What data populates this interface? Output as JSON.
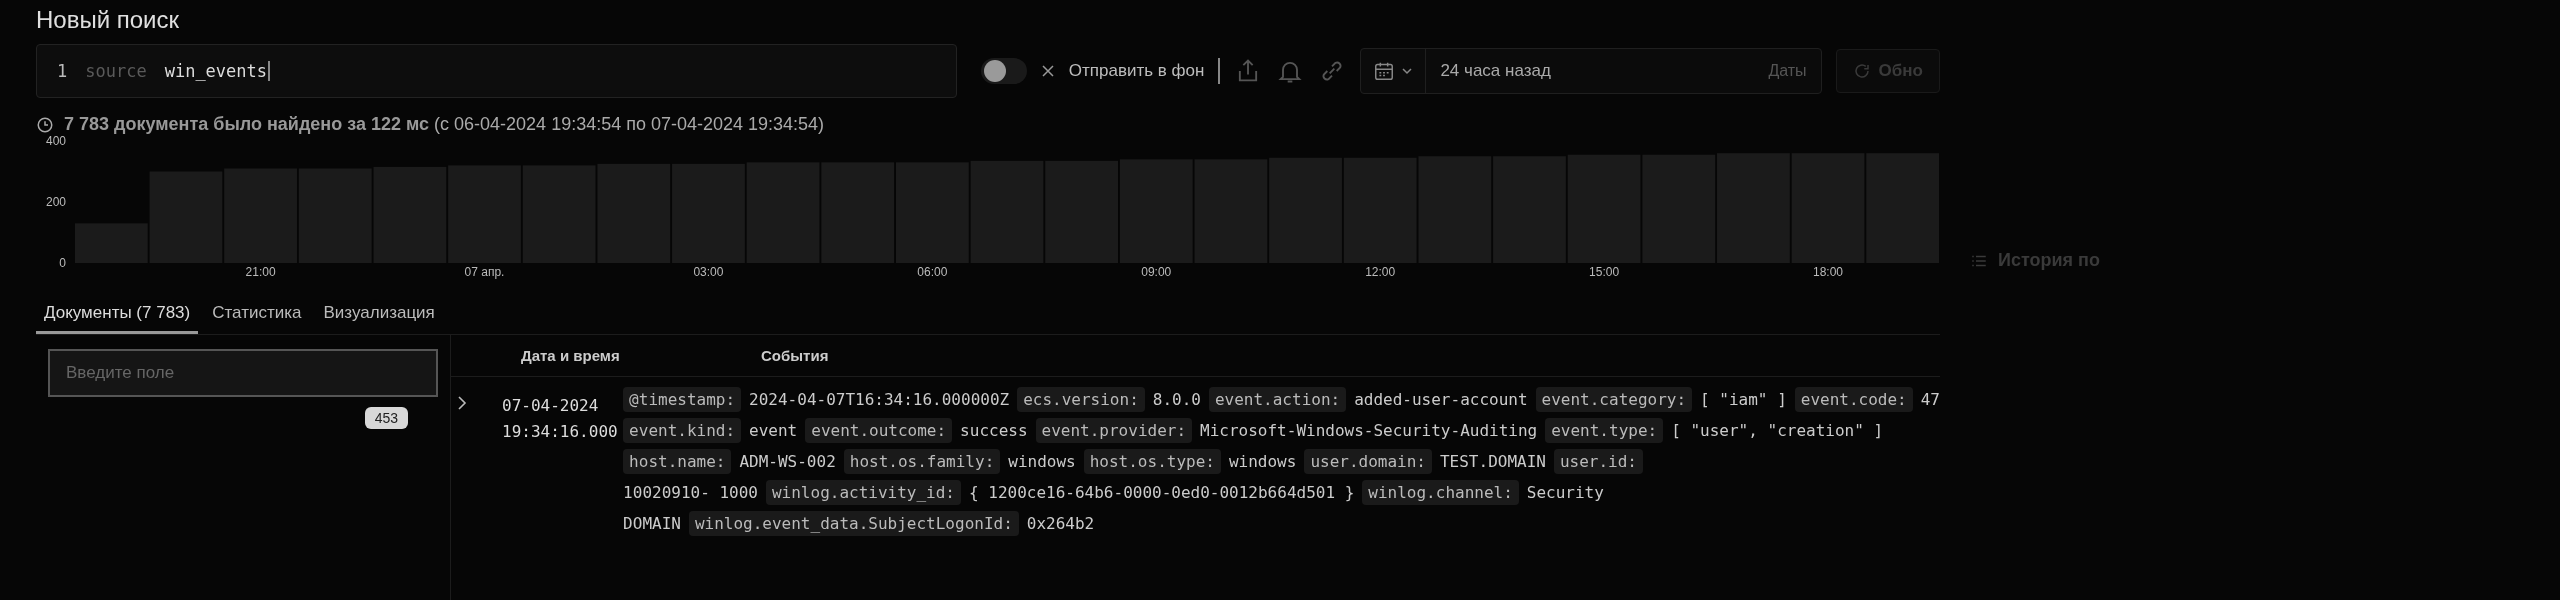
{
  "title": "Новый поиск",
  "query": {
    "line_number": "1",
    "keyword": "source",
    "value": "win_events"
  },
  "background_toggle": {
    "on": false,
    "label": "Отправить в фон"
  },
  "date_range": {
    "value": "24 часа назад",
    "label": "Даты"
  },
  "refresh_button": {
    "label": "Обно"
  },
  "summary": "**7 783 документа было найдено за 122 мс** (с 06-04-2024 19:34:54 по 07-04-2024 19:34:54)",
  "chart_data": {
    "type": "bar",
    "categories": [
      null,
      null,
      "21:00",
      null,
      null,
      "07 апр.",
      null,
      null,
      "03:00",
      null,
      null,
      "06:00",
      null,
      null,
      "09:00",
      null,
      null,
      "12:00",
      null,
      null,
      "15:00",
      null,
      null,
      "18:00",
      null
    ],
    "values": [
      130,
      300,
      310,
      310,
      315,
      320,
      320,
      325,
      325,
      330,
      330,
      330,
      335,
      335,
      340,
      340,
      345,
      345,
      350,
      350,
      355,
      355,
      360,
      360,
      360
    ],
    "ylim": [
      0,
      400
    ],
    "yticks": [
      0,
      200,
      400
    ]
  },
  "history_panel": {
    "title": "История по"
  },
  "tabs": [
    {
      "label": "Документы (7 783)",
      "selected": true
    },
    {
      "label": "Статистика",
      "selected": false
    },
    {
      "label": "Визуализация",
      "selected": false
    }
  ],
  "field_search": {
    "placeholder": "Введите поле"
  },
  "field_count": "453",
  "table": {
    "columns": [
      "Дата и время",
      "События"
    ],
    "rows": [
      {
        "expanded": false,
        "date": "07-04-2024",
        "time": "19:34:16.000",
        "lines": [
          [
            {
              "key": "@timestamp:",
              "value": "2024-04-07T16:34:16.000000Z"
            },
            {
              "key": "ecs.version:",
              "value": "8.0.0"
            },
            {
              "key": "event.action:",
              "value": "added-user-account"
            },
            {
              "key": "event.category:",
              "value": "[ \"iam\" ]"
            },
            {
              "key": "event.code:",
              "value": "47"
            }
          ],
          [
            {
              "key": "event.kind:",
              "value": "event"
            },
            {
              "key": "event.outcome:",
              "value": "success"
            },
            {
              "key": "event.provider:",
              "value": "Microsoft-Windows-Security-Auditing"
            },
            {
              "key": "event.type:",
              "value": "[ \"user\", \"creation\" ]"
            }
          ],
          [
            {
              "key": "host.name:",
              "value": "ADM-WS-002"
            },
            {
              "key": "host.os.family:",
              "value": "windows"
            },
            {
              "key": "host.os.type:",
              "value": "windows"
            },
            {
              "key": "user.domain:",
              "value": "TEST.DOMAIN"
            },
            {
              "key": "user.id:"
            }
          ],
          [
            {
              "value": "10020910- 1000"
            },
            {
              "key": "winlog.activity_id:",
              "value": "{ 1200ce16-64b6-0000-0ed0-0012b664d501 }"
            },
            {
              "key": "winlog.channel:",
              "value": "Security"
            }
          ],
          [
            {
              "value": "DOMAIN"
            },
            {
              "key": "winlog.event_data.SubjectLogonId:",
              "value": "0x264b2"
            }
          ]
        ]
      }
    ]
  }
}
